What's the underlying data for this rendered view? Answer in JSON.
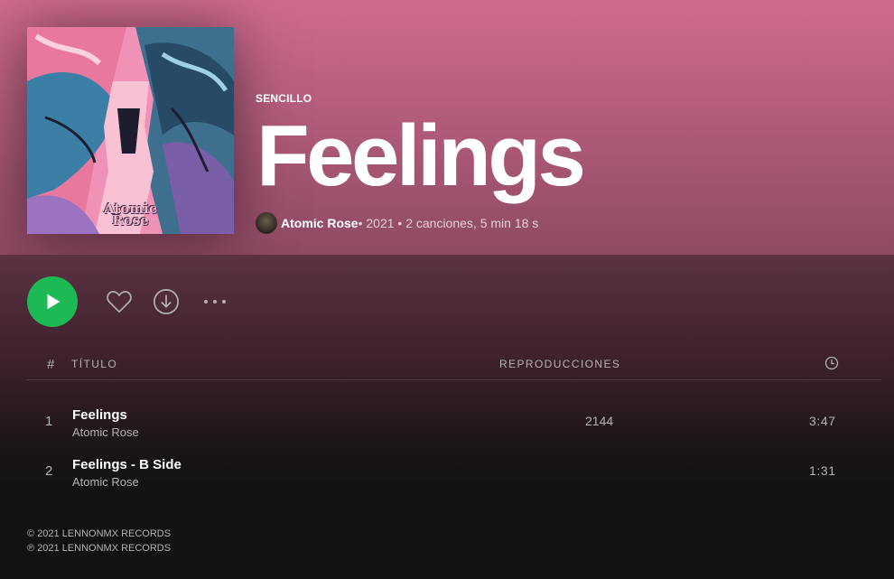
{
  "album": {
    "type_label": "SENCILLO",
    "title": "Feelings",
    "artist": "Atomic Rose",
    "details": " • 2021 • 2 canciones, 5 min 18 s",
    "cover_logo_line1": "Atomic",
    "cover_logo_line2": "Rose"
  },
  "colors": {
    "header_top": "#cf6b8e",
    "accent_green": "#1db954",
    "background": "#121212"
  },
  "controls": {
    "play_icon": "play-icon",
    "like_icon": "heart-icon",
    "download_icon": "download-icon",
    "more_icon": "more-icon"
  },
  "table": {
    "num_header": "#",
    "title_header": "TÍTULO",
    "plays_header": "REPRODUCCIONES",
    "duration_header_icon": "clock-icon"
  },
  "tracks": [
    {
      "number": "1",
      "name": "Feelings",
      "artist": "Atomic Rose",
      "plays": "2144",
      "duration": "3:47"
    },
    {
      "number": "2",
      "name": "Feelings - B Side",
      "artist": "Atomic Rose",
      "plays": "",
      "duration": "1:31"
    }
  ],
  "copyright": {
    "line1": "© 2021 LENNONMX RECORDS",
    "line2": "℗ 2021 LENNONMX RECORDS"
  }
}
